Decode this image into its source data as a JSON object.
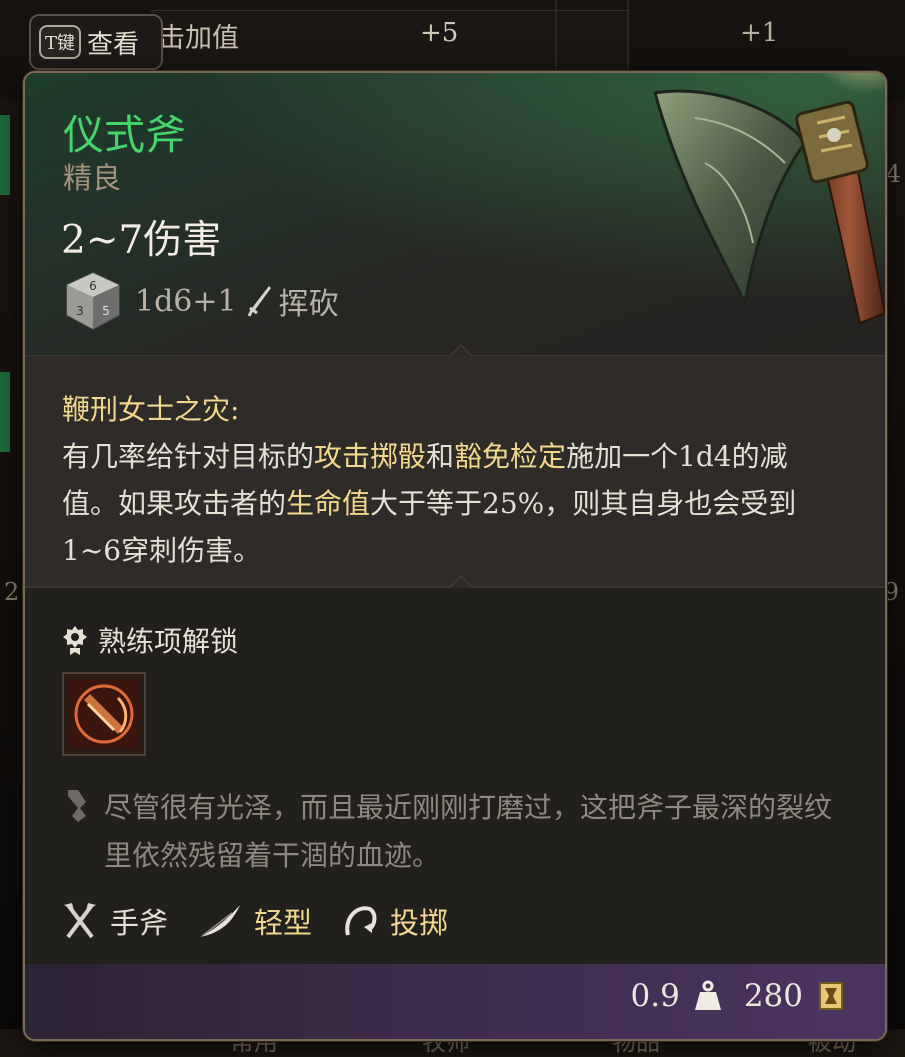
{
  "background": {
    "view_key": "T键",
    "view_label": "查看",
    "stat_label": "击加值",
    "stat_value": "+5",
    "stat_value_2": "+1",
    "tabs": [
      "常用",
      "牧师",
      "物品",
      "被动"
    ],
    "edge_numbers": [
      "4",
      "2",
      "9"
    ]
  },
  "item": {
    "name": "仪式斧",
    "rarity": "精良",
    "damage": "2~7伤害",
    "dice_formula": "1d6+1",
    "damage_type": "挥砍",
    "dice_icon": "d6-dice-icon",
    "damage_type_icon": "slashing-sword-icon"
  },
  "passive": {
    "title": "鞭刑女士之灾:",
    "text_1": "有几率给针对目标的",
    "kw_1": "攻击掷骰",
    "text_2": "和",
    "kw_2": "豁免检定",
    "text_3": "施加一个1d4的减值。如果攻击者的",
    "kw_3": "生命值",
    "text_4": "大于等于25%，则其自身也会受到1~6穿刺伤害。"
  },
  "proficiency": {
    "label": "熟练项解锁",
    "icon": "proficiency-badge-icon",
    "action_icon": "cleave-action-icon"
  },
  "flavor": {
    "text": "尽管很有光泽，而且最近刚刚打磨过，这把斧子最深的裂纹里依然残留着干涸的血迹。"
  },
  "properties": [
    {
      "label": "手斧",
      "icon": "crossed-axes-icon",
      "highlight": false
    },
    {
      "label": "轻型",
      "icon": "feather-icon",
      "highlight": true
    },
    {
      "label": "投掷",
      "icon": "throw-arc-icon",
      "highlight": true
    }
  ],
  "footer": {
    "weight": "0.9",
    "weight_icon": "weight-icon",
    "price": "280",
    "price_icon": "gold-coin-icon"
  },
  "colors": {
    "item_name": "#45d46a",
    "keyword": "#f3d88c",
    "footer_purple": "#4a3560"
  }
}
